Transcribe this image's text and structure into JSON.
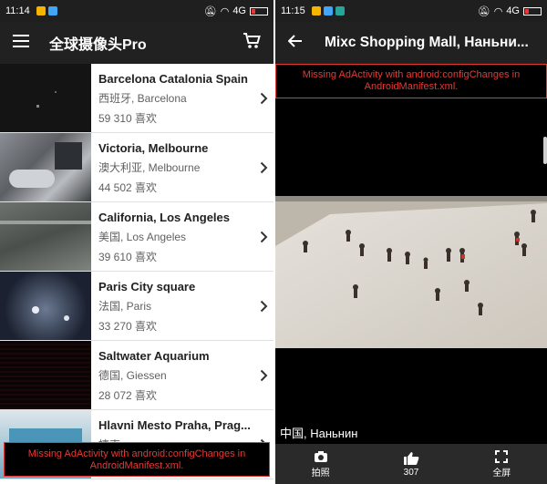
{
  "left": {
    "status": {
      "time": "11:14",
      "network": "4G"
    },
    "appbar": {
      "title": "全球摄像头Pro"
    },
    "cameras": [
      {
        "name": "Barcelona Catalonia Spain",
        "location": "西班牙, Barcelona",
        "likes": "59 310 喜欢"
      },
      {
        "name": "Victoria, Melbourne",
        "location": "澳大利亚, Melbourne",
        "likes": "44 502 喜欢"
      },
      {
        "name": "California, Los Angeles",
        "location": "美国, Los Angeles",
        "likes": "39 610 喜欢"
      },
      {
        "name": "Paris City square",
        "location": "法国, Paris",
        "likes": "33 270 喜欢"
      },
      {
        "name": "Saltwater Aquarium",
        "location": "德国, Giessen",
        "likes": "28 072 喜欢"
      },
      {
        "name": "Hlavni Mesto Praha, Prag...",
        "location": "捷克",
        "likes": ""
      }
    ],
    "ad_warning": "Missing AdActivity with android:configChanges in AndroidManifest.xml."
  },
  "right": {
    "status": {
      "time": "11:15",
      "network": "4G"
    },
    "appbar": {
      "title": "Mixc Shopping Mall, Наньни..."
    },
    "ad_warning": "Missing AdActivity with android:configChanges in AndroidManifest.xml.",
    "caption": "中国, Наньнин",
    "controls": [
      {
        "label": "拍照",
        "icon": "camera-icon"
      },
      {
        "label": "307",
        "icon": "thumbs-up-icon"
      },
      {
        "label": "全屏",
        "icon": "fullscreen-icon"
      }
    ]
  },
  "colors": {
    "appbar": "#212121",
    "warning": "#e53935",
    "controls": "#2a2a2a"
  }
}
